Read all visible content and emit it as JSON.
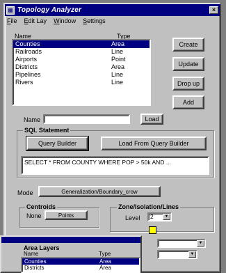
{
  "window": {
    "title": "Topology Analyzer",
    "close_glyph": "×"
  },
  "menu": [
    "File",
    "Edit Lay",
    "Window",
    "Settings"
  ],
  "layers": {
    "header_name": "Name",
    "header_type": "Type",
    "rows": [
      {
        "name": "Counties",
        "type": "Area",
        "selected": true
      },
      {
        "name": "Railroads",
        "type": "Line",
        "selected": false
      },
      {
        "name": "Airports",
        "type": "Point",
        "selected": false
      },
      {
        "name": "Districts",
        "type": "Area",
        "selected": false
      },
      {
        "name": "Pipelines",
        "type": "Line",
        "selected": false
      },
      {
        "name": "Rivers",
        "type": "Line",
        "selected": false
      }
    ]
  },
  "buttons": {
    "create": "Create",
    "update": "Update",
    "drop": "Drop up",
    "add": "Add",
    "name_load": "Load",
    "query_builder": "Query Builder",
    "load_from_query": "Load From Query Builder"
  },
  "name_field": {
    "label": "Name",
    "value": ""
  },
  "sql": {
    "group_title": "SQL Statement",
    "text": "SELECT * FROM COUNTY WHERE POP > 50k AND ..."
  },
  "mode": {
    "label": "Mode",
    "value": "Generalization/Boundary_crow"
  },
  "centroid": {
    "title": "Centroids",
    "prefix": "None",
    "value": "Points"
  },
  "labels": {
    "title": "Zone/Isolation/Lines",
    "label": "Level",
    "value": "2",
    "accent_color": "#ffff00"
  },
  "area_layers": {
    "title": "Area Layers",
    "header_name": "Name",
    "header_type": "Type",
    "rows": [
      {
        "name": "Counties",
        "type": "Area",
        "selected": true
      },
      {
        "name": "Districts",
        "type": "Area",
        "selected": false
      }
    ]
  },
  "colors": {
    "title_bar": "#000080",
    "selection": "#000080",
    "face": "#c0c0c0"
  }
}
